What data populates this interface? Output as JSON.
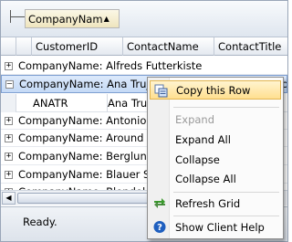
{
  "group_panel": {
    "chip_label": "CompanyNam",
    "sort_icon": "triangle-up-icon"
  },
  "columns": [
    "CustomerID",
    "ContactName",
    "ContactTitle"
  ],
  "groups": [
    {
      "label": "CompanyName: Alfreds Futterkiste",
      "expanded": false
    },
    {
      "label": "CompanyName: Ana Trujillo Emparedados y helados",
      "expanded": true
    },
    {
      "label": "CompanyName: Antonio Moreno Taquería",
      "expanded": false
    },
    {
      "label": "CompanyName: Around the Horn",
      "expanded": false
    },
    {
      "label": "CompanyName: Berglunds snabbköp",
      "expanded": false
    },
    {
      "label": "CompanyName: Blauer See Delikatessen",
      "expanded": false
    },
    {
      "label": "CompanyName: Blondel père et fils",
      "expanded": false
    }
  ],
  "expanded_row": {
    "customer_id": "ANATR",
    "contact_name": "Ana Trujillo"
  },
  "status_text": "Ready.",
  "context_menu": {
    "items": [
      {
        "label": "Copy this Row",
        "icon": "copy-rows-icon",
        "highlighted": true,
        "enabled": true
      },
      {
        "label": "Expand",
        "icon": "",
        "highlighted": false,
        "enabled": false
      },
      {
        "label": "Expand All",
        "icon": "",
        "highlighted": false,
        "enabled": true
      },
      {
        "label": "Collapse",
        "icon": "",
        "highlighted": false,
        "enabled": true
      },
      {
        "label": "Collapse All",
        "icon": "",
        "highlighted": false,
        "enabled": true
      },
      {
        "label": "Refresh Grid",
        "icon": "refresh-arrows-icon",
        "highlighted": false,
        "enabled": true
      },
      {
        "label": "Show Client Help",
        "icon": "help-icon",
        "highlighted": false,
        "enabled": true
      }
    ]
  },
  "colors": {
    "selection": "#c5daf6",
    "menu_highlight": "#ffdf90",
    "refresh_icon": "#3a9a2c",
    "help_icon": "#1f5fbf"
  }
}
